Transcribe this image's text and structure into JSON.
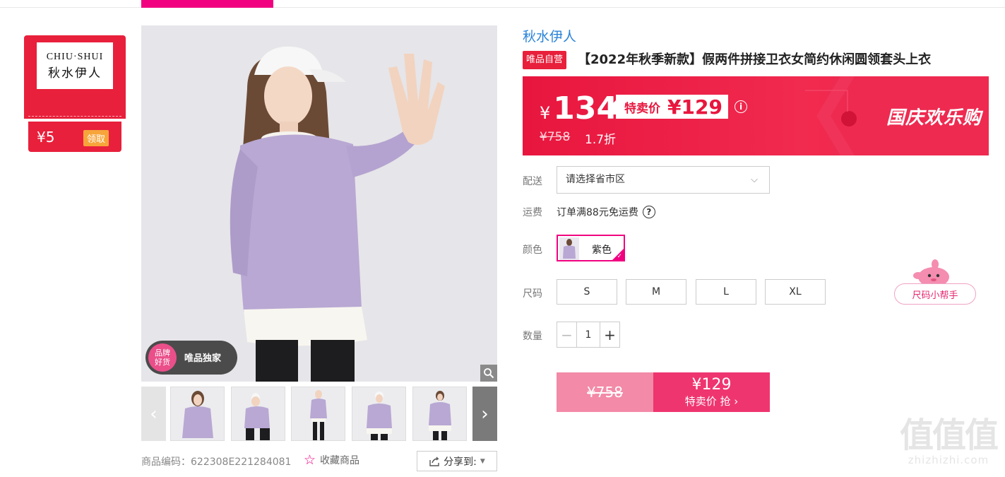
{
  "colors": {
    "accent": "#f10180",
    "price_red": "#e8163e",
    "brand_blue": "#2a83d8",
    "buy_pink": "#ef3570"
  },
  "brand_card": {
    "logo_en": "CHIU·SHUI",
    "logo_cn": "秋水伊人",
    "coupon_value": "¥5",
    "coupon_button": "领取"
  },
  "gallery": {
    "badge_circle": "品牌好货",
    "badge_text": "唯品独家",
    "thumbnails_count": 5,
    "product_code_label": "商品编码：622308E221284081",
    "favorite_label": "收藏商品",
    "share_label": "分享到:"
  },
  "product": {
    "brand": "秋水伊人",
    "self_tag": "唯品自营",
    "title": "【2022年秋季新款】假两件拼接卫衣女简约休闲圆领套头上衣"
  },
  "price": {
    "currency": "¥",
    "current": "134",
    "sale_label": "特卖价",
    "sale_price": "¥129",
    "original": "¥758",
    "discount": "1.7折",
    "promo": "国庆欢乐购"
  },
  "options": {
    "delivery_label": "配送",
    "delivery_placeholder": "请选择省市区",
    "shipping_label": "运费",
    "shipping_text": "订单满88元免运费",
    "color_label": "颜色",
    "color_selected": "紫色",
    "size_label": "尺码",
    "sizes": [
      "S",
      "M",
      "L",
      "XL"
    ],
    "qty_label": "数量",
    "qty_value": "1",
    "size_helper": "尺码小帮手"
  },
  "buy": {
    "original": "¥758",
    "price": "¥129",
    "label": "特卖价 抢 ›"
  },
  "watermark": {
    "big": "值值值",
    "small": "zhizhizhi.com"
  }
}
